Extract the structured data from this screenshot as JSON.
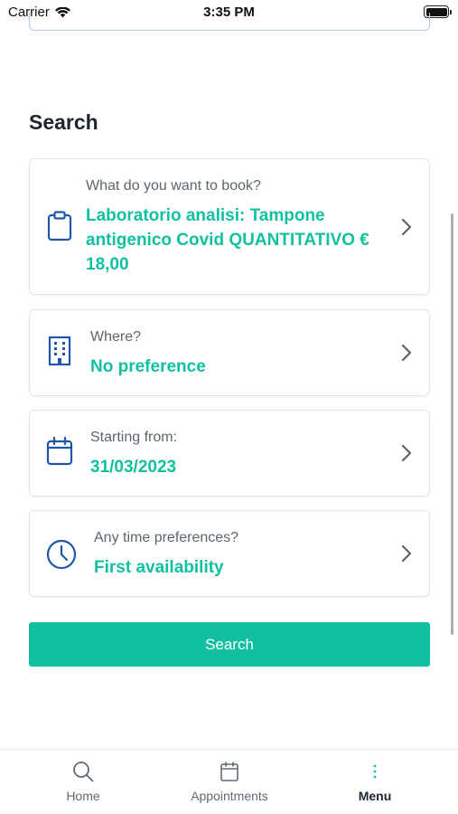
{
  "status_bar": {
    "carrier": "Carrier",
    "time": "3:35 PM"
  },
  "search": {
    "title": "Search",
    "what": {
      "label": "What do you want to book?",
      "value": "Laboratorio analisi: Tampone antigenico Covid QUANTITATIVO € 18,00",
      "icon": "clipboard-icon"
    },
    "where": {
      "label": "Where?",
      "value": "No preference",
      "icon": "building-icon"
    },
    "starting": {
      "label": "Starting from:",
      "value": "31/03/2023",
      "icon": "calendar-icon"
    },
    "time": {
      "label": "Any time preferences?",
      "value": "First availability",
      "icon": "clock-icon"
    },
    "button_label": "Search"
  },
  "tabbar": {
    "home": "Home",
    "appointments": "Appointments",
    "menu": "Menu",
    "active": "Menu"
  },
  "colors": {
    "accent": "#0fbf9f",
    "value_text": "#10c0a0",
    "icon_blue": "#1f57a8"
  }
}
